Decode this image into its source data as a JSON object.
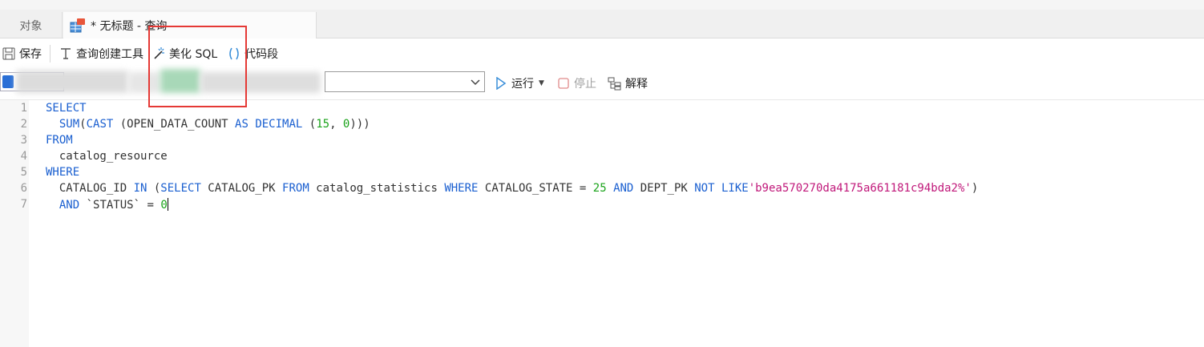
{
  "tabs": {
    "objects": "对象",
    "query": "* 无标题 - 查询"
  },
  "toolbar": {
    "save": "保存",
    "query_builder": "查询创建工具",
    "beautify_sql": "美化 SQL",
    "code_snippet": "代码段"
  },
  "toolbar2": {
    "run": "运行",
    "stop": "停止",
    "explain": "解释"
  },
  "editor": {
    "line_numbers": [
      "1",
      "2",
      "3",
      "4",
      "5",
      "6",
      "7"
    ],
    "lines": [
      [
        {
          "t": "SELECT",
          "c": "kw"
        }
      ],
      [
        {
          "t": "  "
        },
        {
          "t": "SUM",
          "c": "kw"
        },
        {
          "t": "("
        },
        {
          "t": "CAST",
          "c": "kw"
        },
        {
          "t": " (OPEN_DATA_COUNT "
        },
        {
          "t": "AS",
          "c": "kw"
        },
        {
          "t": " "
        },
        {
          "t": "DECIMAL",
          "c": "kw"
        },
        {
          "t": " ("
        },
        {
          "t": "15",
          "c": "num"
        },
        {
          "t": ", "
        },
        {
          "t": "0",
          "c": "num"
        },
        {
          "t": ")))"
        }
      ],
      [
        {
          "t": "FROM",
          "c": "kw"
        }
      ],
      [
        {
          "t": "  catalog_resource"
        }
      ],
      [
        {
          "t": "WHERE",
          "c": "kw"
        }
      ],
      [
        {
          "t": "  CATALOG_ID "
        },
        {
          "t": "IN",
          "c": "kw"
        },
        {
          "t": " ("
        },
        {
          "t": "SELECT",
          "c": "kw"
        },
        {
          "t": " CATALOG_PK "
        },
        {
          "t": "FROM",
          "c": "kw"
        },
        {
          "t": " catalog_statistics "
        },
        {
          "t": "WHERE",
          "c": "kw"
        },
        {
          "t": " CATALOG_STATE = "
        },
        {
          "t": "25",
          "c": "num"
        },
        {
          "t": " "
        },
        {
          "t": "AND",
          "c": "kw"
        },
        {
          "t": " DEPT_PK "
        },
        {
          "t": "NOT",
          "c": "kw"
        },
        {
          "t": " "
        },
        {
          "t": "LIKE",
          "c": "kw"
        },
        {
          "t": "'b9ea570270da4175a661181c94bda2%'",
          "c": "str"
        },
        {
          "t": ")"
        }
      ],
      [
        {
          "t": "  "
        },
        {
          "t": "AND",
          "c": "kw"
        },
        {
          "t": " `STATUS` = "
        },
        {
          "t": "0",
          "c": "num"
        }
      ]
    ]
  },
  "colors": {
    "keyword": "#1a5fd0",
    "number": "#1aa31a",
    "string": "#c0187a",
    "highlight": "#e53935"
  }
}
